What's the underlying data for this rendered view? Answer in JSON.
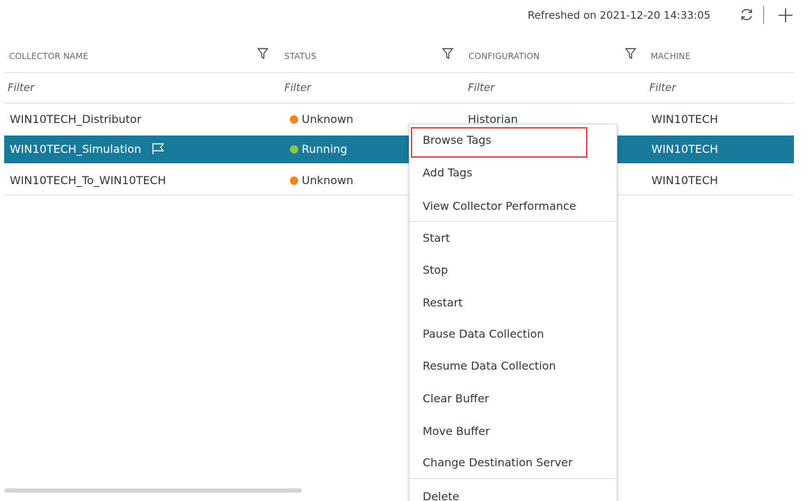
{
  "toolbar": {
    "refreshed_text": "Refreshed on 2021-12-20 14:33:05",
    "refresh_icon": "refresh-icon",
    "add_icon": "plus-icon"
  },
  "table": {
    "columns": [
      {
        "label": "COLLECTOR NAME",
        "filter_placeholder": "Filter"
      },
      {
        "label": "STATUS",
        "filter_placeholder": "Filter"
      },
      {
        "label": "CONFIGURATION",
        "filter_placeholder": "Filter"
      },
      {
        "label": "MACHINE",
        "filter_placeholder": "Filter"
      }
    ],
    "rows": [
      {
        "name": "WIN10TECH_Distributor",
        "status": "Unknown",
        "status_color": "#f5821f",
        "configuration": "Historian",
        "machine": "WIN10TECH",
        "selected": false
      },
      {
        "name": "WIN10TECH_Simulation",
        "status": "Running",
        "status_color": "#8dc63f",
        "configuration": "",
        "machine": "WIN10TECH",
        "selected": true
      },
      {
        "name": "WIN10TECH_To_WIN10TECH",
        "status": "Unknown",
        "status_color": "#f5821f",
        "configuration": "",
        "machine": "WIN10TECH",
        "selected": false
      }
    ]
  },
  "context_menu": {
    "items": [
      {
        "label": "Browse Tags",
        "highlighted": true
      },
      {
        "label": "Add Tags"
      },
      {
        "label": "View Collector Performance"
      },
      {
        "label": "Start"
      },
      {
        "label": "Stop"
      },
      {
        "label": "Restart"
      },
      {
        "label": "Pause Data Collection"
      },
      {
        "label": "Resume Data Collection"
      },
      {
        "label": "Clear Buffer"
      },
      {
        "label": "Move Buffer"
      },
      {
        "label": "Change Destination Server"
      },
      {
        "label": "Delete"
      }
    ]
  },
  "colors": {
    "selected_row": "#1a7a9c",
    "highlight_border": "#e04545"
  }
}
